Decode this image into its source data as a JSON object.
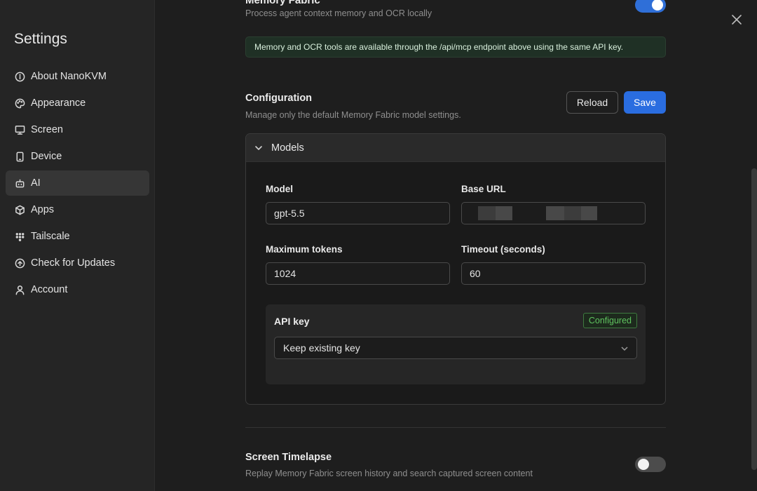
{
  "sidebar": {
    "title": "Settings",
    "items": [
      {
        "label": "About NanoKVM",
        "icon": "info-icon"
      },
      {
        "label": "Appearance",
        "icon": "palette-icon"
      },
      {
        "label": "Screen",
        "icon": "monitor-icon"
      },
      {
        "label": "Device",
        "icon": "smartphone-icon"
      },
      {
        "label": "AI",
        "icon": "bot-icon",
        "active": true
      },
      {
        "label": "Apps",
        "icon": "package-icon"
      },
      {
        "label": "Tailscale",
        "icon": "grid-dots-icon"
      },
      {
        "label": "Check for Updates",
        "icon": "arrow-up-circle-icon"
      },
      {
        "label": "Account",
        "icon": "user-icon"
      }
    ]
  },
  "memory_fabric": {
    "title": "Memory Fabric",
    "subtitle": "Process agent context memory and OCR locally",
    "enabled": true,
    "notice": "Memory and OCR tools are available through the /api/mcp endpoint above using the same API key."
  },
  "configuration": {
    "title": "Configuration",
    "subtitle": "Manage only the default Memory Fabric model settings.",
    "reload_label": "Reload",
    "save_label": "Save"
  },
  "models": {
    "header": "Models",
    "model_label": "Model",
    "model_value": "gpt-5.5",
    "base_url_label": "Base URL",
    "max_tokens_label": "Maximum tokens",
    "max_tokens_value": "1024",
    "timeout_label": "Timeout (seconds)",
    "timeout_value": "60",
    "api_key_label": "API key",
    "api_key_status": "Configured",
    "api_key_selected": "Keep existing key"
  },
  "timelapse": {
    "title": "Screen Timelapse",
    "subtitle": "Replay Memory Fabric screen history and search captured screen content",
    "enabled": false
  },
  "colors": {
    "accent": "#2a6de0",
    "toggle_on": "#2f6fd8",
    "badge_green": "#5fc35f",
    "notice_bg": "#1f3025"
  }
}
